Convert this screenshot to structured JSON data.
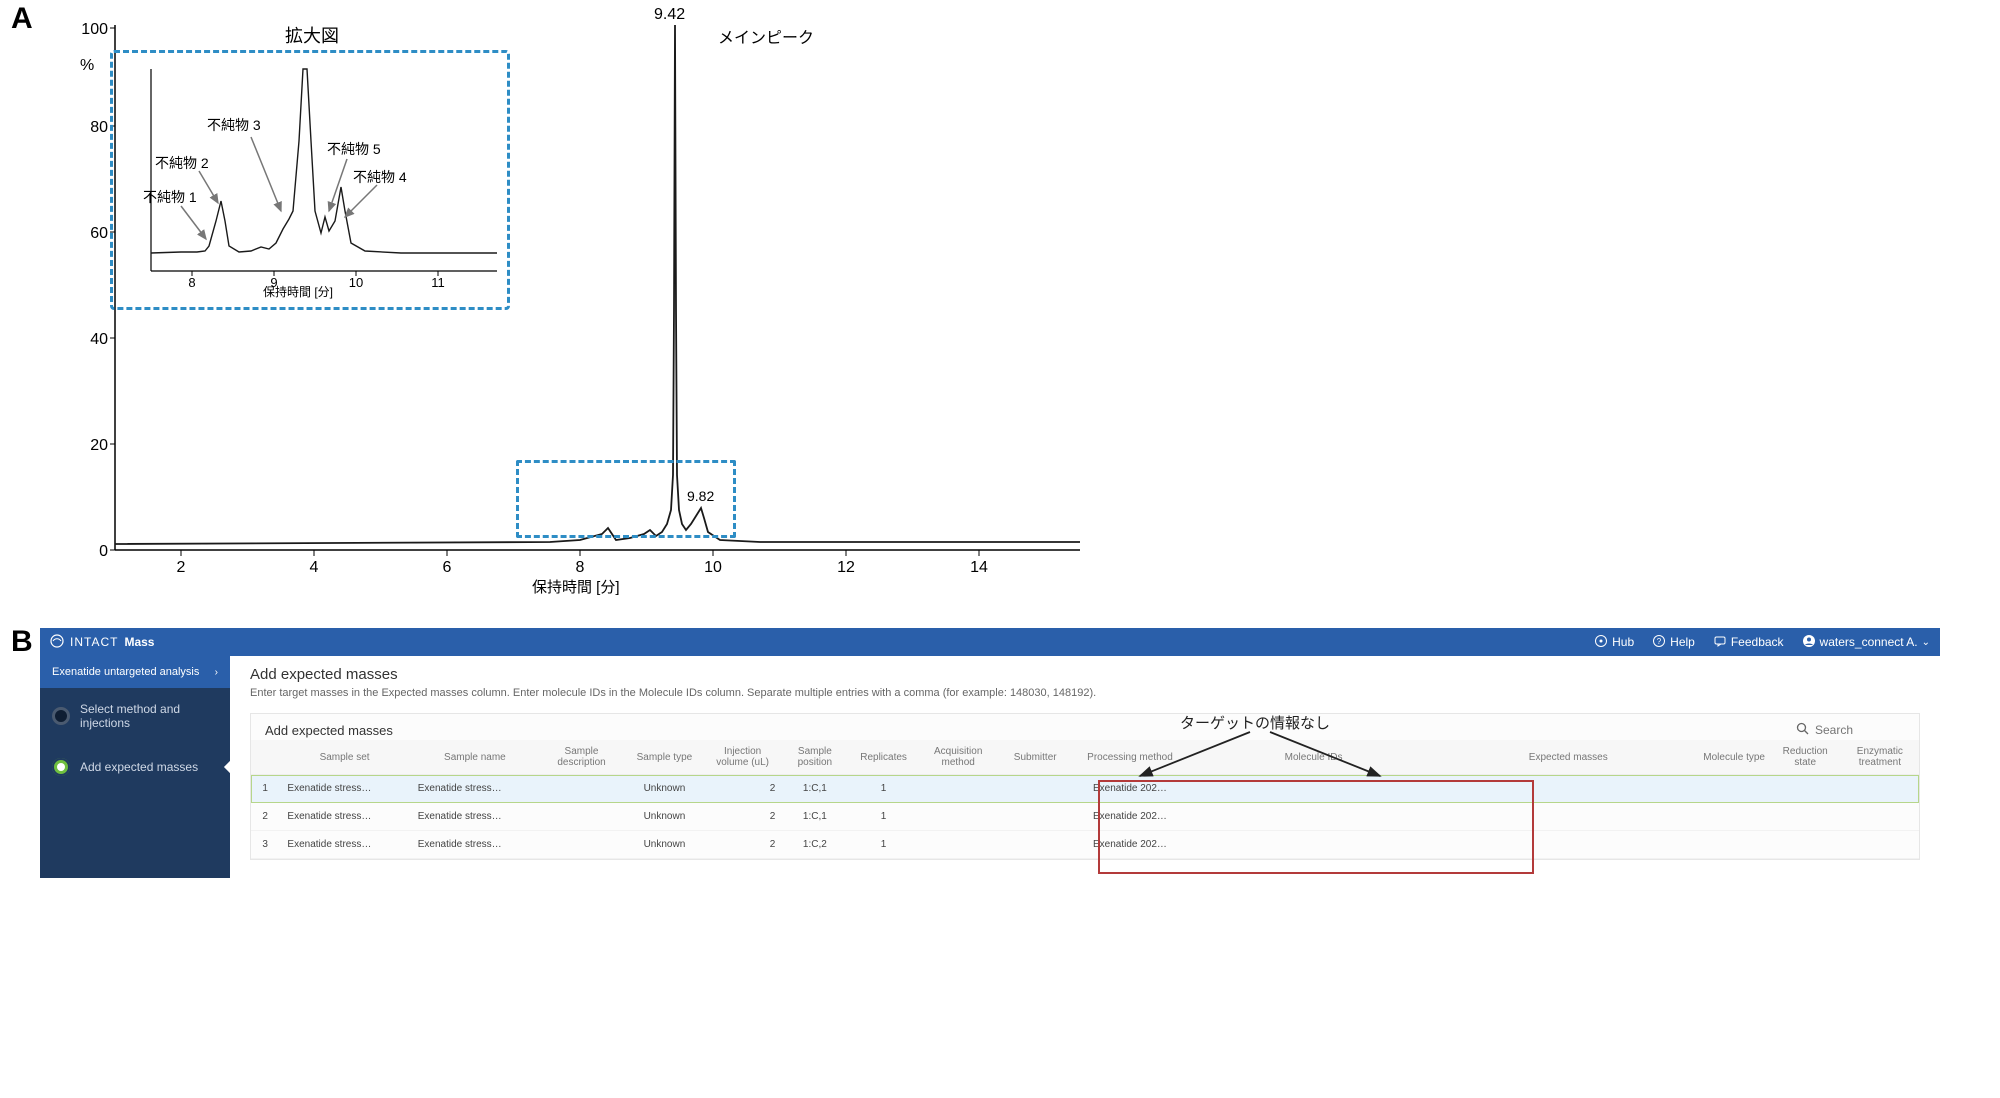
{
  "panel_labels": {
    "a": "A",
    "b": "B"
  },
  "chart_data": [
    {
      "id": "main",
      "type": "line",
      "title": "",
      "xlabel": "保持時間 [分]",
      "ylabel": "%",
      "xlim": [
        1,
        15.5
      ],
      "ylim": [
        0,
        100
      ],
      "xticks": [
        2,
        4,
        6,
        8,
        10,
        12,
        14
      ],
      "yticks": [
        0,
        20,
        40,
        60,
        80,
        100
      ],
      "peaks": [
        {
          "x": 9.42,
          "y": 100,
          "label": "9.42",
          "name": "メインピーク"
        },
        {
          "x": 9.82,
          "y": 8,
          "label": "9.82"
        }
      ],
      "baseline_y": 1.5,
      "zoom_region_x": [
        7.6,
        10.5
      ],
      "zoom_title": "拡大図"
    },
    {
      "id": "inset",
      "type": "line",
      "title": "",
      "xlabel": "保持時間 [分]",
      "ylabel": "",
      "xlim": [
        7.5,
        11.7
      ],
      "ylim": [
        0,
        1
      ],
      "xticks": [
        8,
        9,
        10,
        11
      ],
      "impurities": [
        {
          "name": "不純物 1",
          "x": 8.1,
          "height": 0.05
        },
        {
          "name": "不純物 2",
          "x": 8.42,
          "height": 0.28
        },
        {
          "name": "不純物 3",
          "x": 9.12,
          "height": 0.22
        },
        {
          "name": "不純物 5",
          "x": 9.62,
          "height": 0.18
        },
        {
          "name": "不純物 4",
          "x": 9.82,
          "height": 0.42
        }
      ],
      "main_peak_x": 9.42,
      "baseline_y": 0.15
    }
  ],
  "app": {
    "title_a": "INTACT",
    "title_b": "Mass",
    "nav": {
      "hub": "Hub",
      "help": "Help",
      "feedback": "Feedback",
      "user": "waters_connect A."
    },
    "sidebar": {
      "crumb": "Exenatide untargeted analysis",
      "step1": "Select method and injections",
      "step2": "Add expected masses"
    },
    "page": {
      "heading": "Add expected masses",
      "sub": "Enter target masses in the Expected masses column. Enter molecule IDs in the Molecule IDs column. Separate multiple entries with a comma (for example: 148030, 148192).",
      "table_title": "Add expected masses",
      "search_placeholder": "Search",
      "annotation": "ターゲットの情報なし"
    },
    "columns": [
      "",
      "Sample set",
      "Sample name",
      "Sample description",
      "Sample type",
      "Injection volume (uL)",
      "Sample position",
      "Replicates",
      "Acquisition method",
      "Submitter",
      "Processing method",
      "Molecule IDs",
      "Expected masses",
      "Molecule type",
      "Reduction state",
      "Enzymatic treatment"
    ],
    "rows": [
      {
        "idx": "1",
        "set": "Exenatide stress…",
        "name": "Exenatide stress…",
        "desc": "",
        "type": "Unknown",
        "vol": "2",
        "pos": "1:C,1",
        "rep": "1",
        "acq": "",
        "sub": "",
        "proc": "Exenatide 202…"
      },
      {
        "idx": "2",
        "set": "Exenatide stress…",
        "name": "Exenatide stress…",
        "desc": "",
        "type": "Unknown",
        "vol": "2",
        "pos": "1:C,1",
        "rep": "1",
        "acq": "",
        "sub": "",
        "proc": "Exenatide 202…"
      },
      {
        "idx": "3",
        "set": "Exenatide stress…",
        "name": "Exenatide stress…",
        "desc": "",
        "type": "Unknown",
        "vol": "2",
        "pos": "1:C,2",
        "rep": "1",
        "acq": "",
        "sub": "",
        "proc": "Exenatide 202…"
      }
    ]
  }
}
